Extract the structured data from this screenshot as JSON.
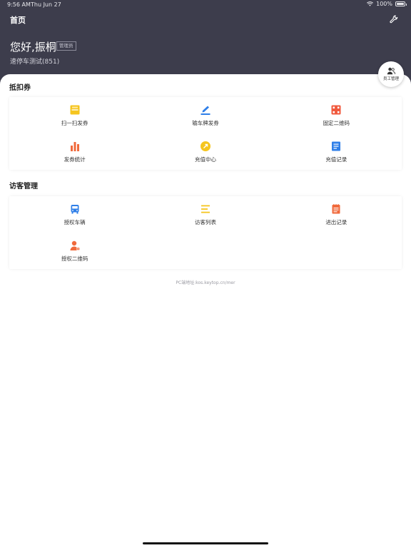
{
  "status": {
    "time": "9:56 AM",
    "date": "Thu Jun 27",
    "battery": "100%"
  },
  "header": {
    "title": "首页",
    "greeting": "您好,振桐",
    "role_badge": "管理员",
    "store_name": "速停车测试(851)"
  },
  "staff_button": {
    "label": "员工管理"
  },
  "sections": [
    {
      "title": "抵扣券",
      "items": [
        {
          "label": "扫一扫发券",
          "icon": "scan-icon",
          "color": "#f5c51f"
        },
        {
          "label": "输车牌发券",
          "icon": "edit-plate-icon",
          "color": "#2f7fe8"
        },
        {
          "label": "固定二维码",
          "icon": "qrcode-icon",
          "color": "#f0583c"
        },
        {
          "label": "发券统计",
          "icon": "bar-chart-icon",
          "color": "#f06a3c"
        },
        {
          "label": "充值中心",
          "icon": "recharge-icon",
          "color": "#f5c51f"
        },
        {
          "label": "充值记录",
          "icon": "document-icon",
          "color": "#2f7fe8"
        }
      ]
    },
    {
      "title": "访客管理",
      "items": [
        {
          "label": "授权车辆",
          "icon": "bus-icon",
          "color": "#2f7fe8"
        },
        {
          "label": "访客列表",
          "icon": "list-icon",
          "color": "#f5c51f"
        },
        {
          "label": "进出记录",
          "icon": "notebook-icon",
          "color": "#f06a3c"
        },
        {
          "label": "授权二维码",
          "icon": "user-qr-icon",
          "color": "#f06a3c"
        }
      ]
    }
  ],
  "footer": {
    "url_text": "PC端地址:kos.keytop.cn/mer"
  }
}
